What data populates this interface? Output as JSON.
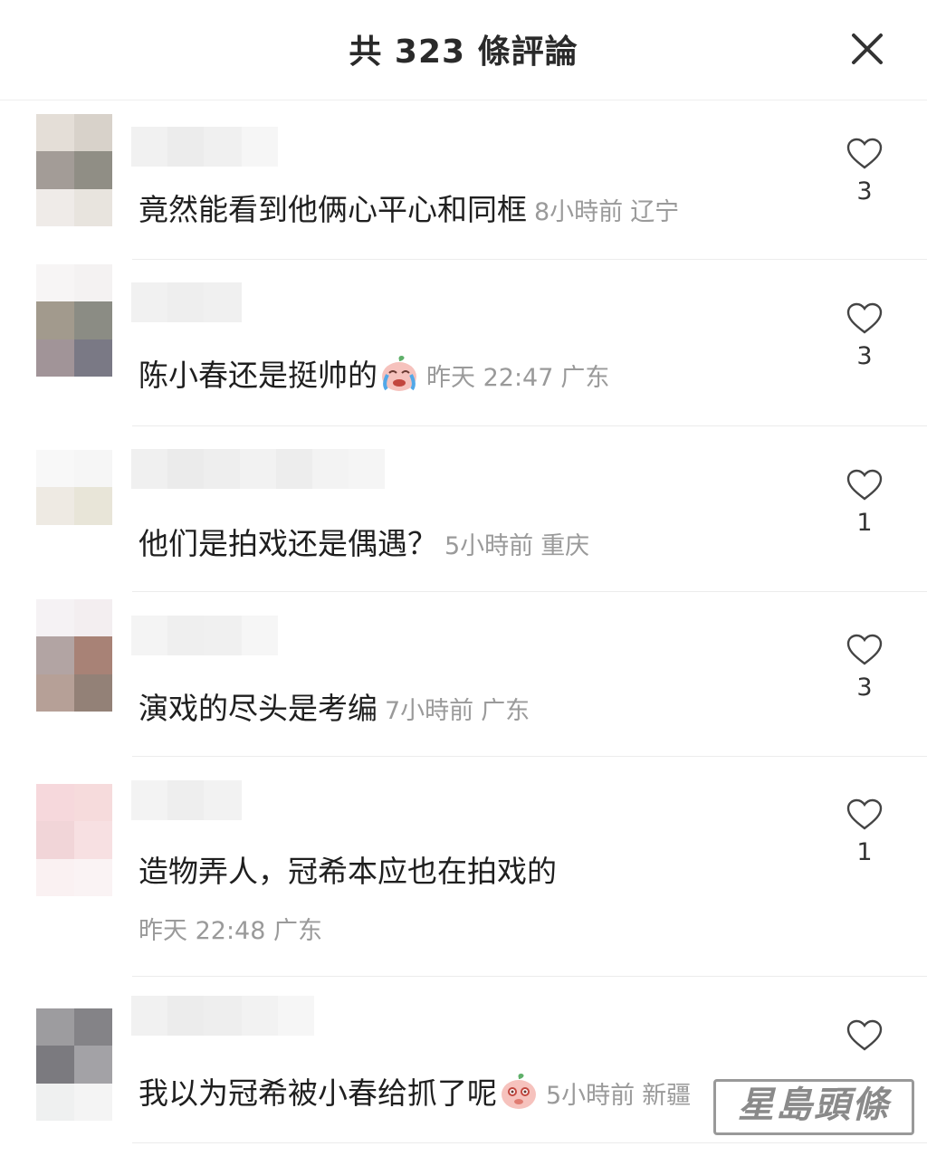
{
  "header": {
    "title": "共 323 條評論"
  },
  "comments": [
    {
      "text": "竟然能看到他俩心平心和同框",
      "time": "8小時前",
      "region": "辽宁",
      "likes": "3",
      "avatar_colors": [
        "#e4ded7",
        "#d8d2ca",
        "#a39c97",
        "#908e85",
        "#efebe8",
        "#e8e4de"
      ]
    },
    {
      "text": "陈小春还是挺帅的",
      "time": "昨天 22:47",
      "region": "广东",
      "likes": "3",
      "avatar_colors": [
        "#f7f5f5",
        "#f4f2f2",
        "#a29a8d",
        "#8b8c84",
        "#a19498",
        "#7a7985"
      ]
    },
    {
      "text": "他们是拍戏还是偶遇？",
      "time": "5小時前",
      "region": "重庆",
      "likes": "1",
      "avatar_colors": [
        "#f8f8f8",
        "#f6f6f6",
        "#eeeae3",
        "#e8e5d8",
        "#ffffff",
        "#ffffff"
      ]
    },
    {
      "text": "演戏的尽头是考编",
      "time": "7小時前",
      "region": "广东",
      "likes": "3",
      "avatar_colors": [
        "#f5f2f4",
        "#f3eef0",
        "#b2a4a3",
        "#a88276",
        "#b6a097",
        "#938177"
      ]
    },
    {
      "text": "造物弄人，冠希本应也在拍戏的",
      "time": "昨天 22:48",
      "region": "广东",
      "likes": "1",
      "avatar_colors": [
        "#f6d8dc",
        "#f6dbdc",
        "#f1d5d8",
        "#f7e0e2",
        "#faf1f2",
        "#faf3f4"
      ]
    },
    {
      "text": "我以为冠希被小春给抓了呢",
      "time": "5小時前",
      "region": "新疆",
      "likes": "",
      "avatar_colors": [
        "#9d9c9f",
        "#848387",
        "#7b7a7f",
        "#a3a2a6",
        "#eff0f0",
        "#f4f4f4"
      ]
    }
  ],
  "watermark": "星島頭條",
  "icons": {
    "close": "close-icon",
    "like": "heart-outline-icon",
    "emoji_cry": "crying-peach-emoji",
    "emoji_shy": "shy-peach-emoji"
  }
}
